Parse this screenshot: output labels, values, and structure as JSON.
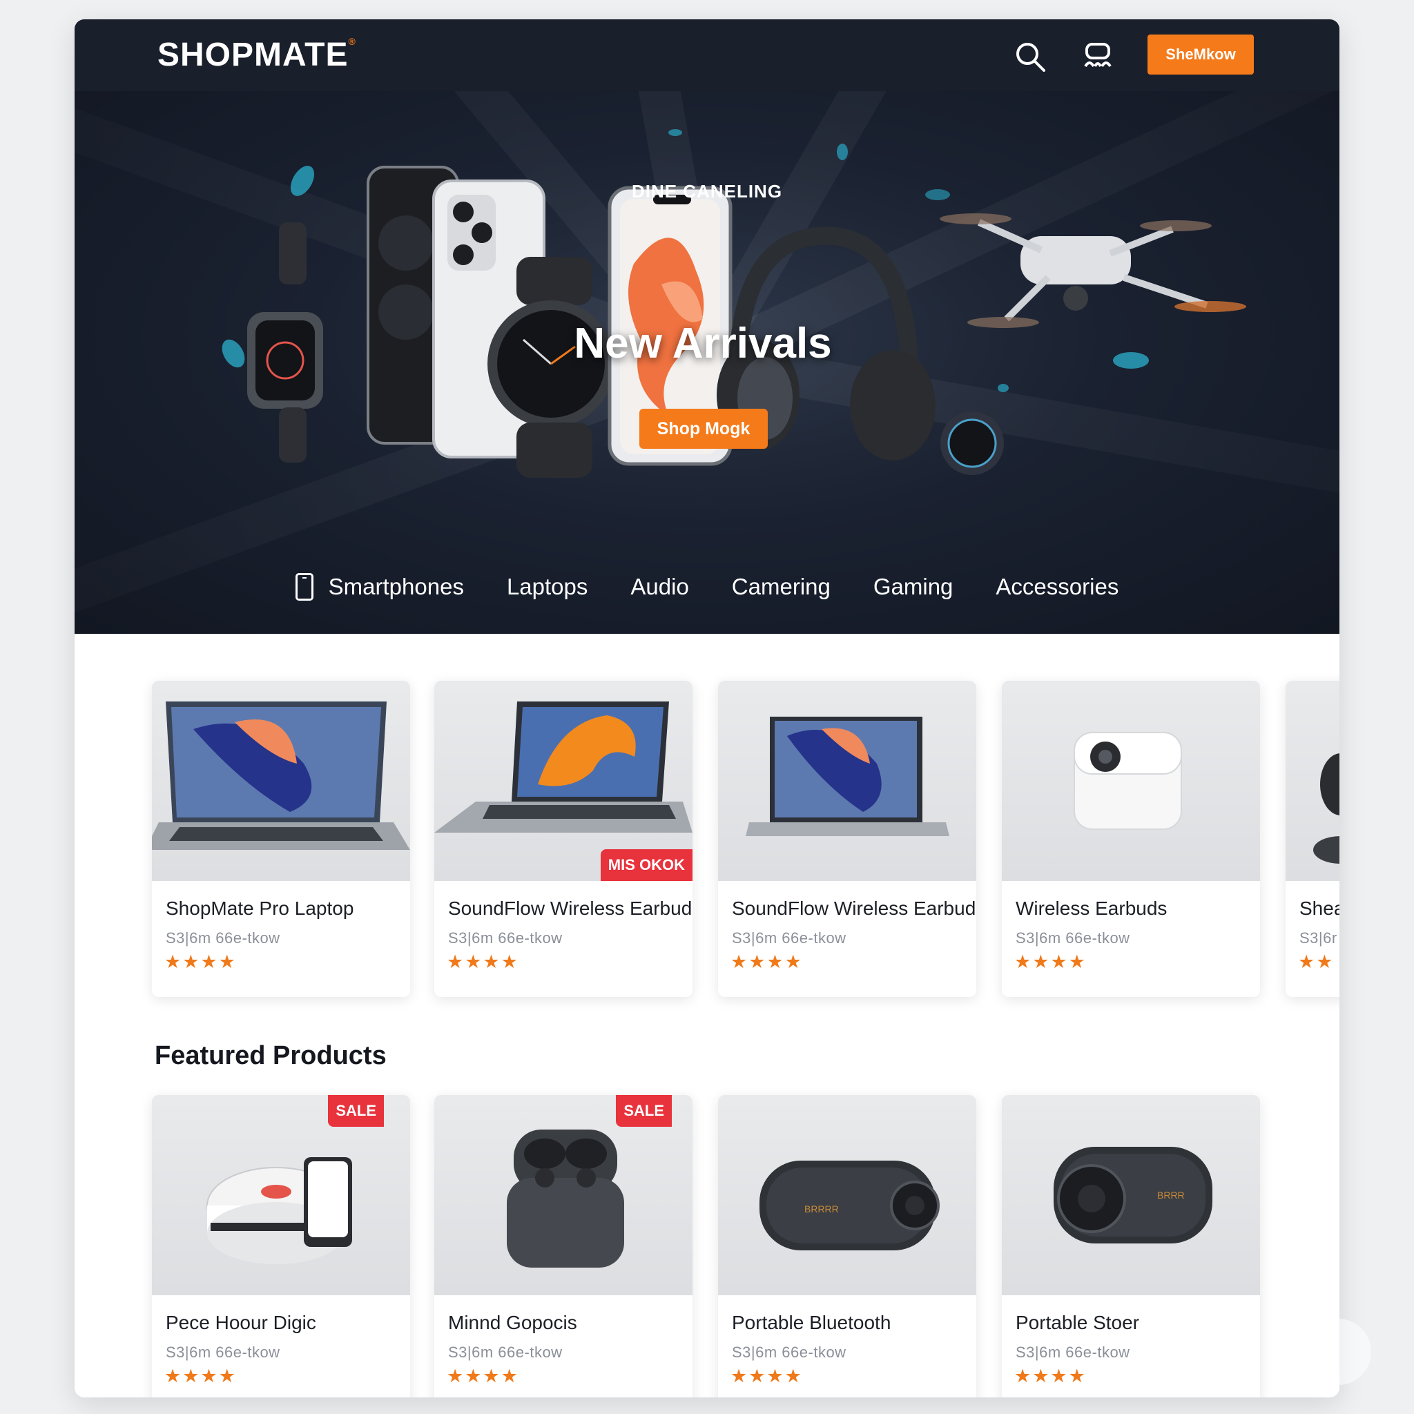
{
  "header": {
    "logo": "SHOPMATE",
    "cta_label": "SheMkow"
  },
  "hero": {
    "eyebrow": "DINE CANELING",
    "title": "New Arrivals",
    "cta_label": "Shop Mogk"
  },
  "categories": [
    "Smartphones",
    "Laptops",
    "Audio",
    "Camering",
    "Gaming",
    "Accessories"
  ],
  "new_arrivals": [
    {
      "name": "ShopMate Pro Laptop",
      "price": "S3|6m  66e-tkow",
      "stars": "★★★★",
      "badge": ""
    },
    {
      "name": "SoundFlow Wireless Earbuds",
      "price": "S3|6m  66e-tkow",
      "stars": "★★★★",
      "badge": "MIS OKOK"
    },
    {
      "name": "SoundFlow Wireless Earbuds",
      "price": "S3|6m  66e-tkow",
      "stars": "★★★★",
      "badge": ""
    },
    {
      "name": "Wireless Earbuds",
      "price": "S3|6m  66e-tkow",
      "stars": "★★★★",
      "badge": ""
    },
    {
      "name": "Shea",
      "price": "S3|6r",
      "stars": "★★",
      "badge": ""
    }
  ],
  "featured": {
    "title": "Featured Products",
    "items": [
      {
        "name": "Pece Hoour Digic",
        "price": "S3|6m  66e-tkow",
        "stars": "★★★★",
        "badge": "SALE"
      },
      {
        "name": "Minnd Gopocis",
        "price": "S3|6m  66e-tkow",
        "stars": "★★★★",
        "badge": "SALE"
      },
      {
        "name": "Portable Bluetooth",
        "price": "S3|6m  66e-tkow",
        "stars": "★★★★",
        "badge": ""
      },
      {
        "name": "Portable Stoer",
        "price": "S3|6m  66e-tkow",
        "stars": "★★★★",
        "badge": ""
      }
    ]
  },
  "icons": [
    "search-icon",
    "account-icon",
    "smartphone-icon"
  ],
  "colors": {
    "accent": "#f47a1a",
    "sale": "#e8323c",
    "header_bg": "#1a1f2c"
  }
}
